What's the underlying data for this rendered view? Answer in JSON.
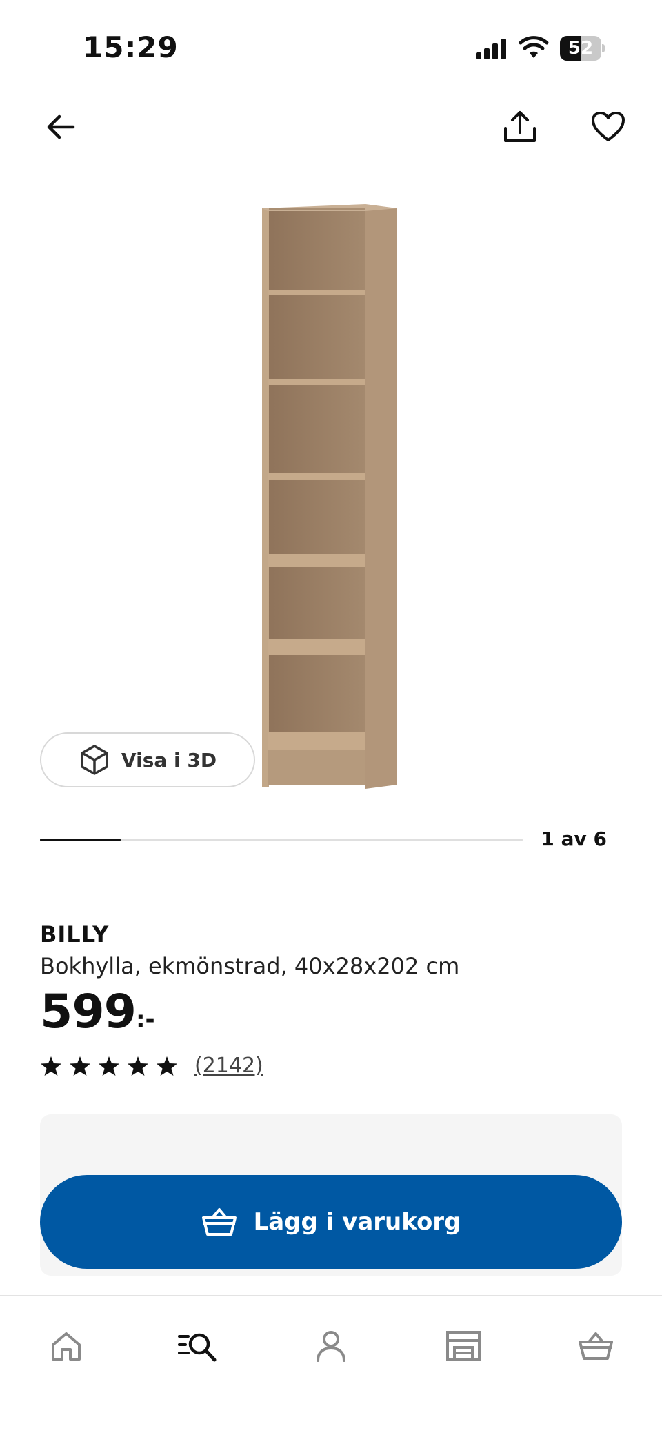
{
  "status_bar": {
    "time": "15:29",
    "battery_level": "52",
    "battery_fraction": 0.52
  },
  "nav": {
    "back_icon": "arrow-left-icon",
    "share_icon": "share-icon",
    "favorite_icon": "heart-icon"
  },
  "gallery": {
    "view_3d_label": "Visa i 3D",
    "position_label": "1 av 6",
    "current": 1,
    "total": 6
  },
  "product": {
    "name": "BILLY",
    "description": "Bokhylla, ekmönstrad, 40x28x202 cm",
    "price": "599",
    "price_suffix": ":-",
    "rating": 5,
    "rating_max": 5,
    "review_count": "(2142)"
  },
  "cart": {
    "add_label": "Lägg i varukorg"
  },
  "bottom_nav": {
    "items": [
      "home-icon",
      "search-icon",
      "profile-icon",
      "store-icon",
      "cart-icon"
    ],
    "active": "search-icon"
  },
  "colors": {
    "brand_blue": "#0058a3",
    "text": "#111111",
    "panel_bg": "#f5f5f5",
    "inactive_icon": "#8a8a8a"
  }
}
